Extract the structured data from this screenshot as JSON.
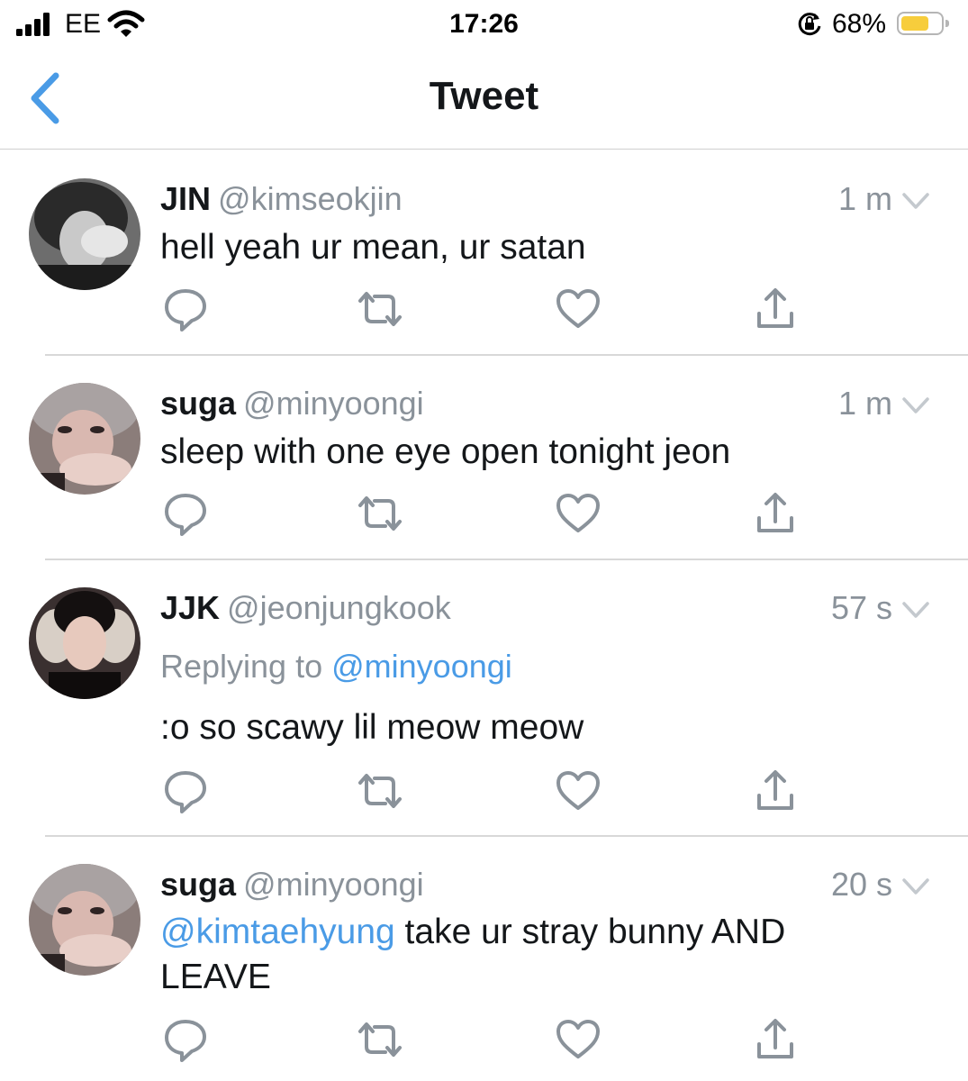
{
  "status_bar": {
    "carrier": "EE",
    "time": "17:26",
    "battery_percent": "68%",
    "battery_level": 0.68,
    "battery_color": "#f7cd3c"
  },
  "nav": {
    "title": "Tweet",
    "back_icon": "chevron-left-icon"
  },
  "colors": {
    "accent": "#4a9be6",
    "secondary_text": "#8a929a"
  },
  "tweets": [
    {
      "name": "JIN",
      "handle": "@kimseokjin",
      "time": "1 m",
      "text": "hell yeah ur mean, ur satan"
    },
    {
      "name": "suga",
      "handle": "@minyoongi",
      "time": "1 m",
      "text": "sleep with one eye open tonight jeon"
    },
    {
      "name": "JJK",
      "handle": "@jeonjungkook",
      "time": "57 s",
      "replying_label": "Replying to",
      "replying_handle": "@minyoongi",
      "text": ":o so scawy lil meow meow"
    },
    {
      "name": "suga",
      "handle": "@minyoongi",
      "time": "20 s",
      "mention": "@kimtaehyung",
      "text_line1": " take ur stray bunny AND",
      "text_line2": "LEAVE"
    }
  ],
  "action_icons": [
    "reply-icon",
    "retweet-icon",
    "like-icon",
    "share-icon"
  ]
}
